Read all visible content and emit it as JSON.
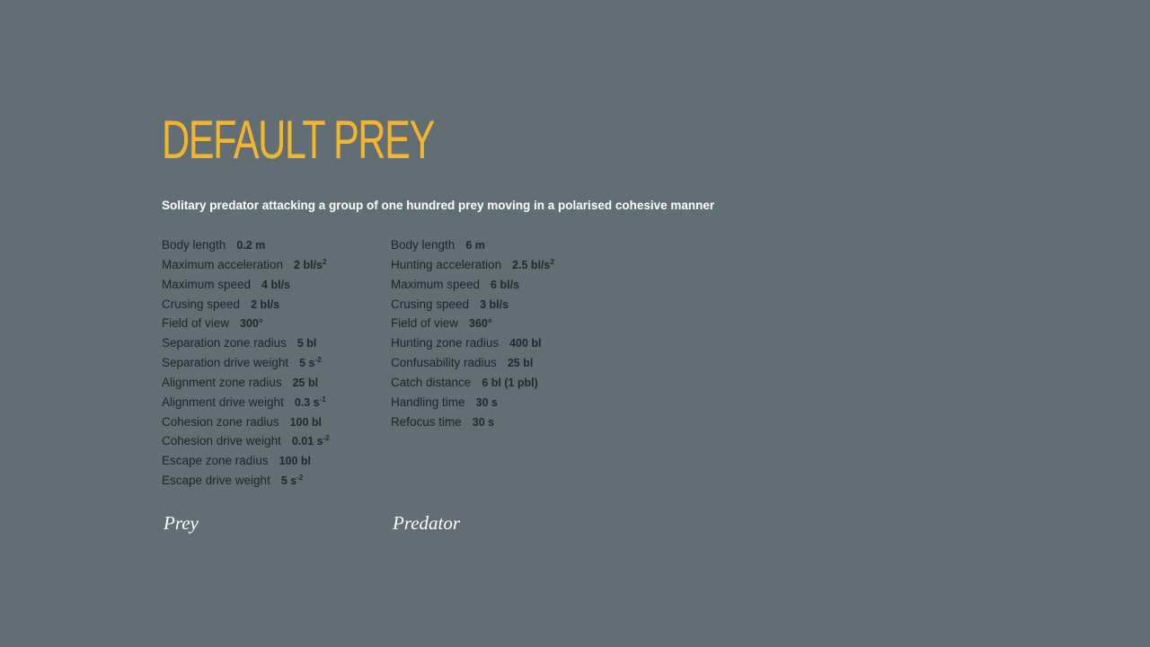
{
  "title": "Default prey",
  "subtitle": "Solitary predator attacking a group of one hundred prey moving in a polarised cohesive manner",
  "prey": {
    "caption": "Prey",
    "params": [
      {
        "label": "Body length",
        "value": "0.2 m",
        "sup": ""
      },
      {
        "label": "Maximum acceleration",
        "value": "2 bl/s",
        "sup": "2"
      },
      {
        "label": "Maximum speed",
        "value": "4 bl/s",
        "sup": ""
      },
      {
        "label": "Crusing speed",
        "value": "2 bl/s",
        "sup": ""
      },
      {
        "label": "Field of view",
        "value": "300°",
        "sup": ""
      },
      {
        "label": "Separation zone radius",
        "value": "5 bl",
        "sup": ""
      },
      {
        "label": "Separation drive weight",
        "value": "5 s",
        "sup": "-2"
      },
      {
        "label": "Alignment zone radius",
        "value": "25 bl",
        "sup": ""
      },
      {
        "label": "Alignment drive weight",
        "value": "0.3 s",
        "sup": "-1"
      },
      {
        "label": "Cohesion zone radius",
        "value": "100 bl",
        "sup": ""
      },
      {
        "label": "Cohesion drive weight",
        "value": "0.01 s",
        "sup": "-2"
      },
      {
        "label": "Escape zone radius",
        "value": "100 bl",
        "sup": ""
      },
      {
        "label": "Escape drive weight",
        "value": "5 s",
        "sup": "-2"
      }
    ]
  },
  "predator": {
    "caption": "Predator",
    "params": [
      {
        "label": "Body length",
        "value": "6 m",
        "sup": ""
      },
      {
        "label": "Hunting acceleration",
        "value": "2.5 bl/s",
        "sup": "2"
      },
      {
        "label": "Maximum speed",
        "value": "6 bl/s",
        "sup": ""
      },
      {
        "label": "Crusing speed",
        "value": "3 bl/s",
        "sup": ""
      },
      {
        "label": "Field of view",
        "value": "360°",
        "sup": ""
      },
      {
        "label": "Hunting zone radius",
        "value": "400 bl",
        "sup": ""
      },
      {
        "label": "Confusability radius",
        "value": "25 bl",
        "sup": ""
      },
      {
        "label": "Catch distance",
        "value": "6 bl (1 pbl)",
        "sup": ""
      },
      {
        "label": "Handling time",
        "value": "30 s",
        "sup": ""
      },
      {
        "label": "Refocus time",
        "value": "30 s",
        "sup": ""
      }
    ]
  },
  "colors": {
    "background": "#636e74",
    "title": "#f2b52e",
    "text": "#1f2326",
    "subtitle": "#ffffff"
  }
}
